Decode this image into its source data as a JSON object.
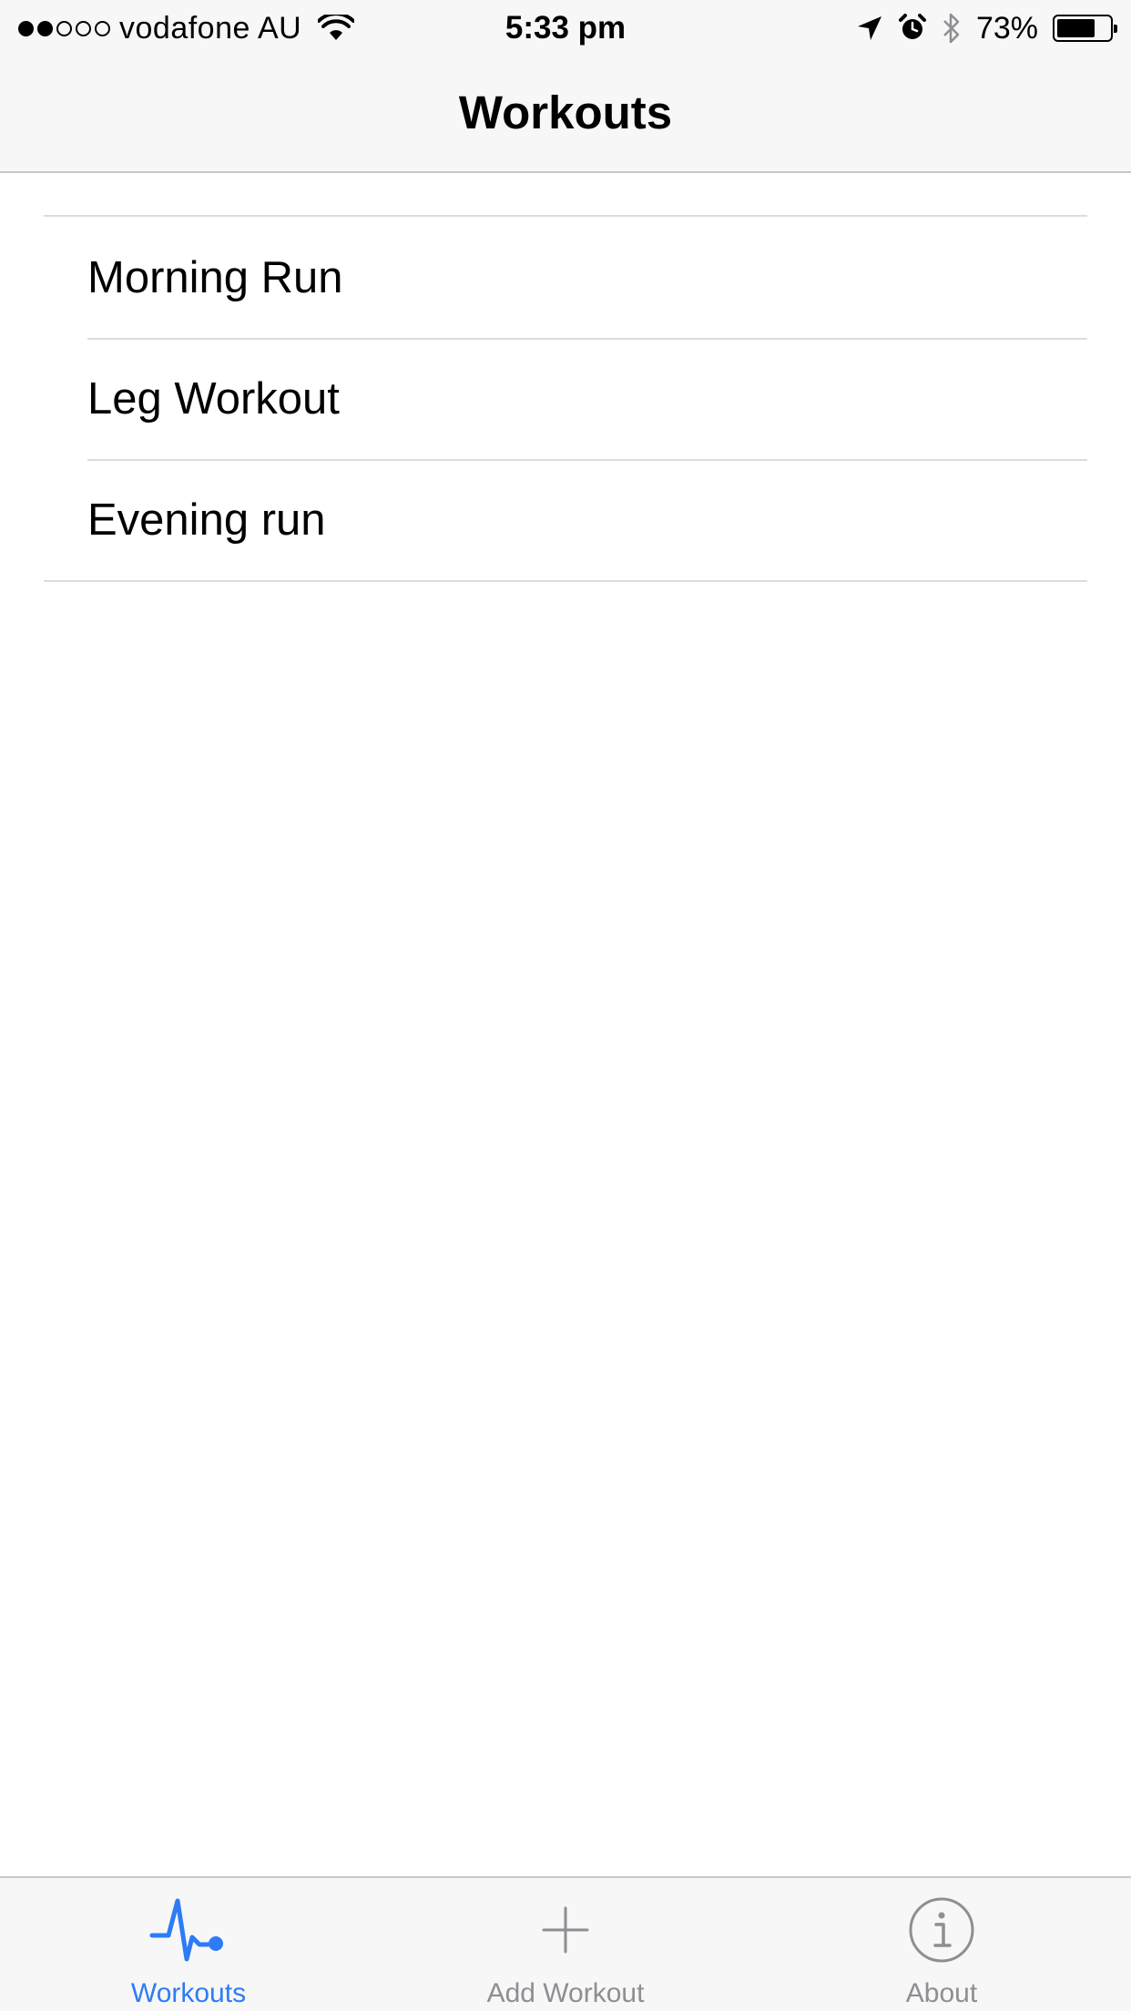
{
  "status_bar": {
    "carrier": "vodafone AU",
    "time": "5:33 pm",
    "battery_percent": "73%",
    "signal_bars_filled": 2,
    "signal_bars_total": 5,
    "battery_level": 0.73,
    "icons": [
      "wifi-icon",
      "location-arrow-icon",
      "alarm-icon",
      "bluetooth-icon",
      "battery-icon"
    ]
  },
  "nav": {
    "title": "Workouts"
  },
  "workouts": [
    {
      "label": "Morning Run"
    },
    {
      "label": "Leg Workout"
    },
    {
      "label": "Evening run"
    }
  ],
  "tab_bar": {
    "tabs": [
      {
        "label": "Workouts",
        "icon": "activity-pulse-icon",
        "active": true
      },
      {
        "label": "Add Workout",
        "icon": "plus-icon",
        "active": false
      },
      {
        "label": "About",
        "icon": "info-icon",
        "active": false
      }
    ]
  },
  "colors": {
    "accent": "#2d7cf6",
    "inactive": "#8e8e93",
    "bar_background": "#f7f7f7",
    "separator": "#dcdcdc"
  }
}
